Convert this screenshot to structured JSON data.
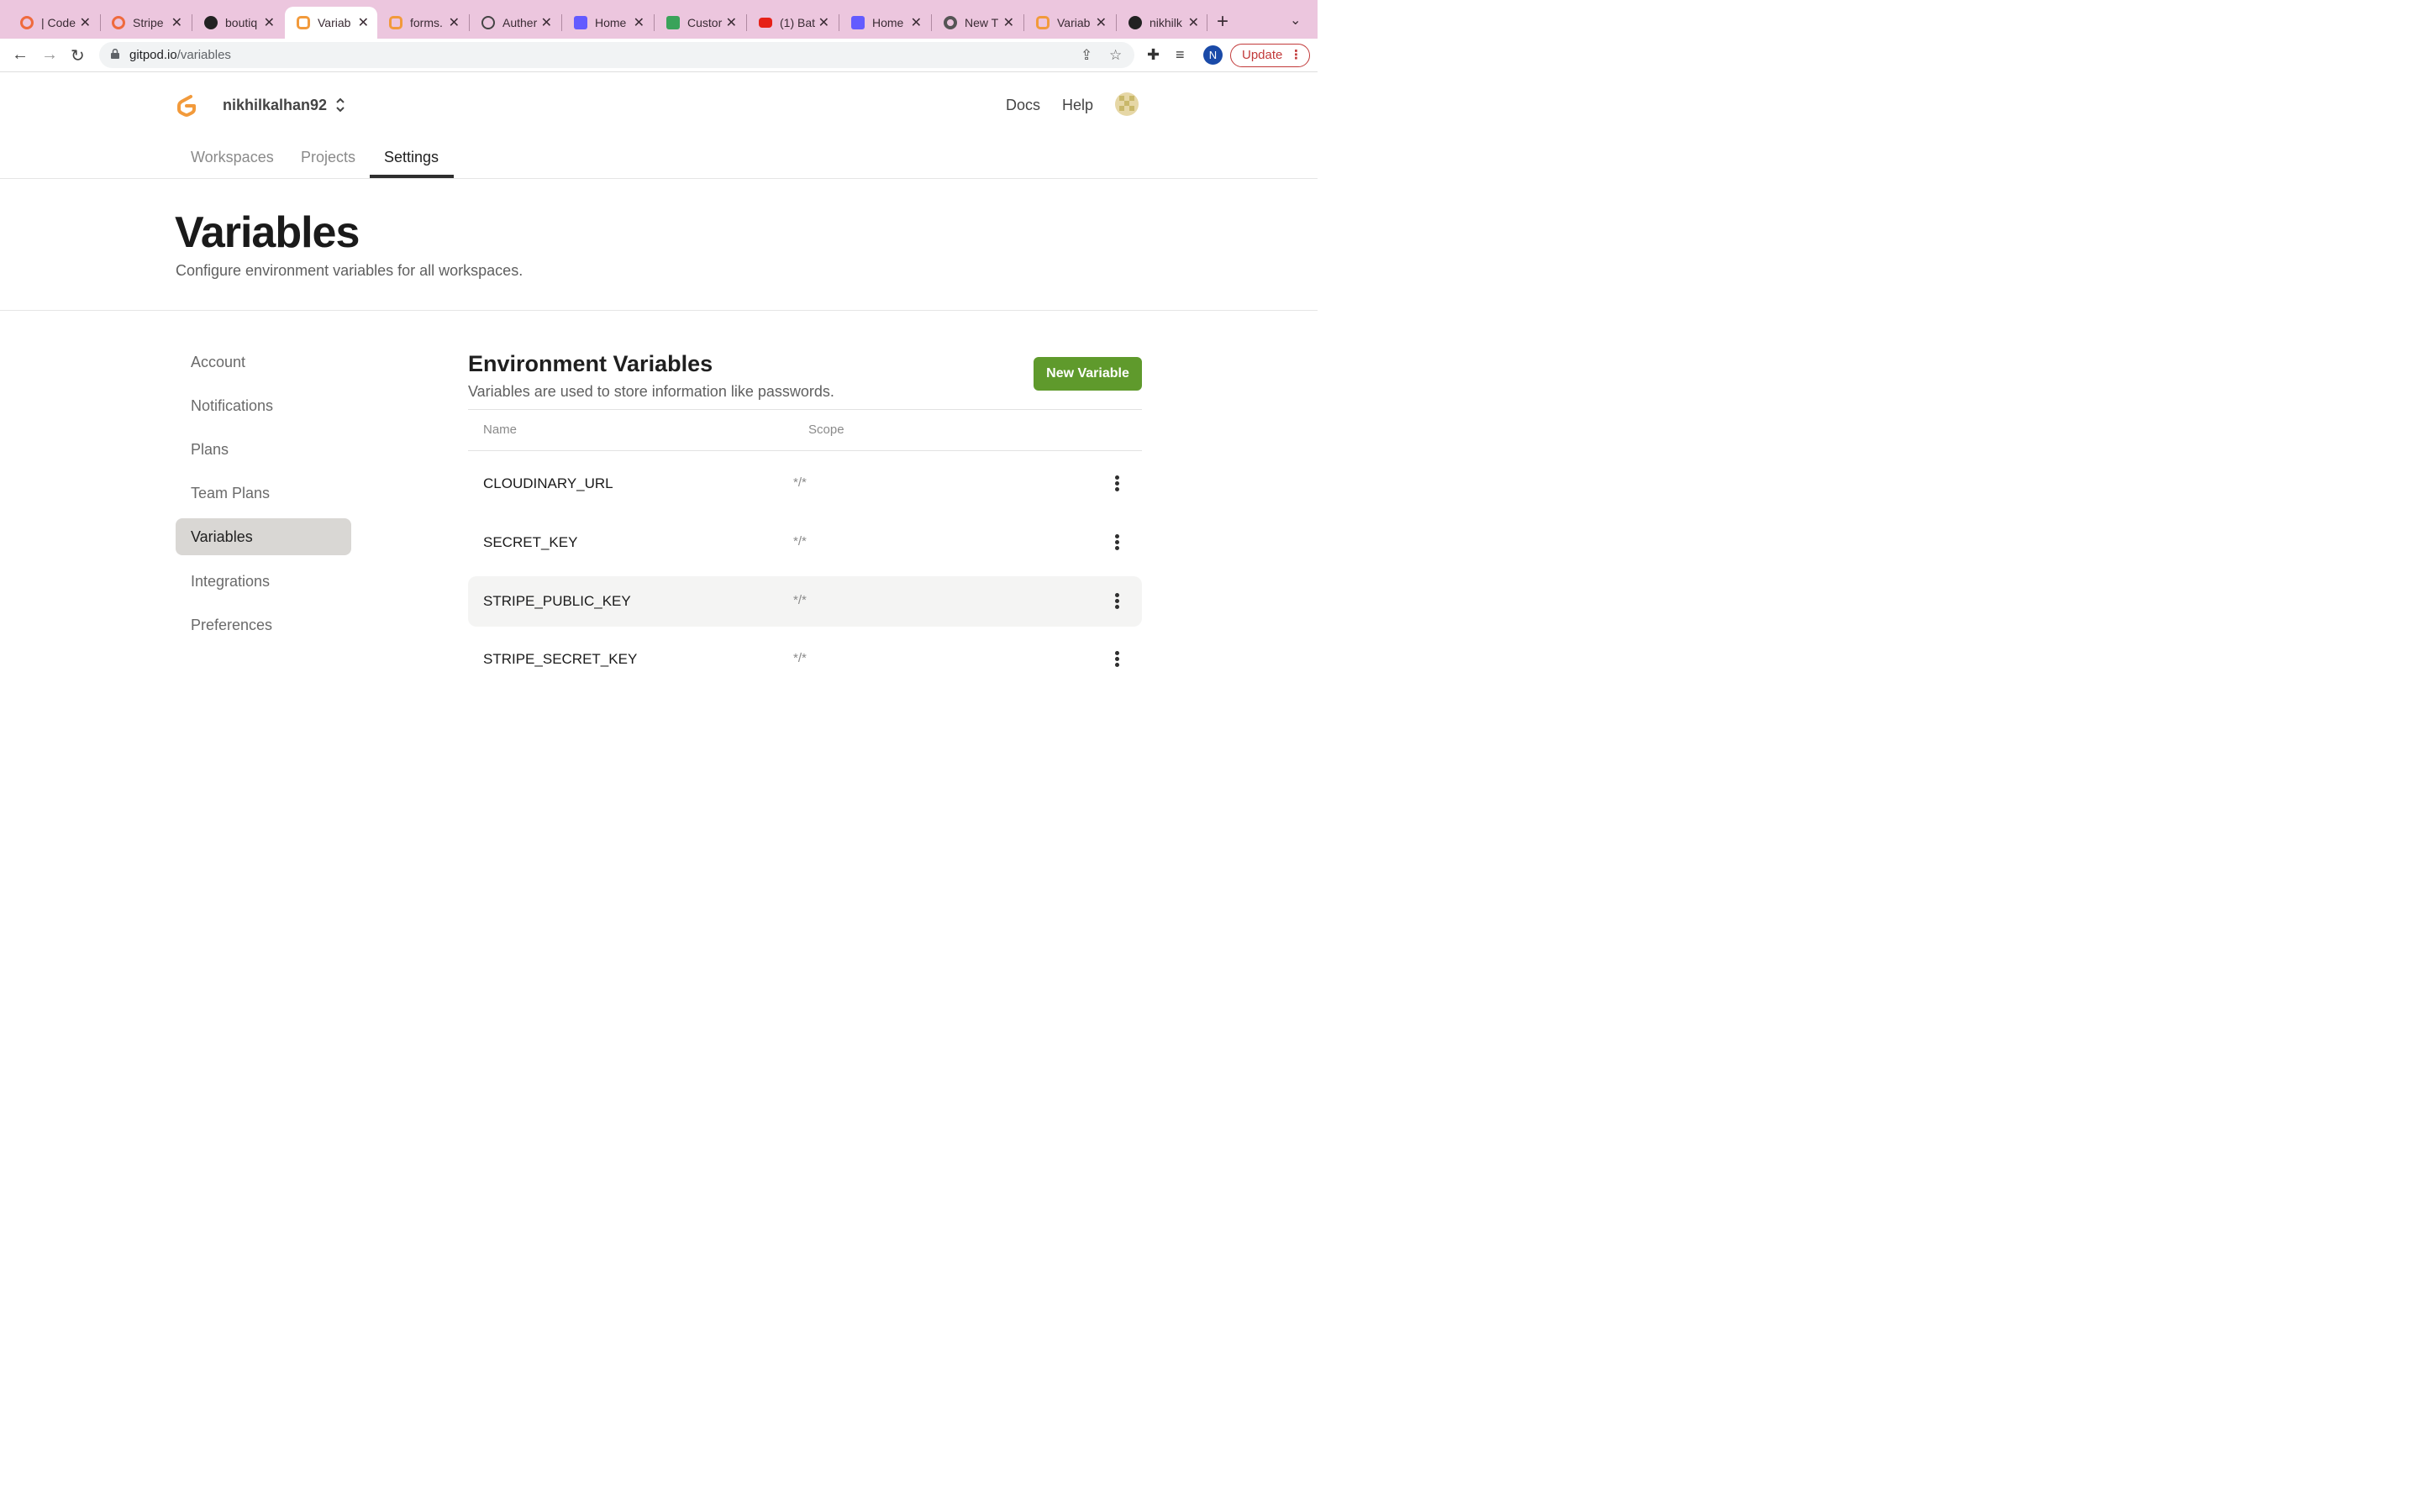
{
  "browser": {
    "tabs": [
      {
        "title": "| Code",
        "icon": "opencollective-icon",
        "color": "#ef6a3d"
      },
      {
        "title": "Stripe",
        "icon": "opencollective-icon",
        "color": "#ef6a3d"
      },
      {
        "title": "boutiq",
        "icon": "github-icon",
        "color": "#222222"
      },
      {
        "title": "Variab",
        "icon": "gitpod-icon",
        "color": "#f29a3b"
      },
      {
        "title": "forms.",
        "icon": "gitpod-icon",
        "color": "#f29a3b"
      },
      {
        "title": "Auther",
        "icon": "globe-icon",
        "color": "#444444"
      },
      {
        "title": "Home",
        "icon": "stripe-icon",
        "color": "#635bff"
      },
      {
        "title": "Custor",
        "icon": "sheets-icon",
        "color": "#3aa35a"
      },
      {
        "title": "(1) Bat",
        "icon": "youtube-icon",
        "color": "#e62117"
      },
      {
        "title": "Home",
        "icon": "stripe-icon",
        "color": "#635bff"
      },
      {
        "title": "New T",
        "icon": "chrome-icon",
        "color": "#555555"
      },
      {
        "title": "Variab",
        "icon": "gitpod-icon",
        "color": "#f29a3b"
      },
      {
        "title": "nikhilk",
        "icon": "github-icon",
        "color": "#222222"
      }
    ],
    "active_tab_index": 3,
    "url_host": "gitpod.io",
    "url_path": "/variables",
    "profile_initial": "N",
    "update_label": "Update",
    "accent_color": "#c23a3a"
  },
  "header": {
    "org_name": "nikhilkalhan92",
    "links": {
      "docs": "Docs",
      "help": "Help"
    },
    "tabs": {
      "workspaces": "Workspaces",
      "projects": "Projects",
      "settings": "Settings"
    },
    "active_tab": "Settings"
  },
  "page": {
    "title": "Variables",
    "subtitle": "Configure environment variables for all workspaces."
  },
  "sidebar": {
    "items": [
      "Account",
      "Notifications",
      "Plans",
      "Team Plans",
      "Variables",
      "Integrations",
      "Preferences"
    ],
    "active": "Variables"
  },
  "env": {
    "title": "Environment Variables",
    "description": "Variables are used to store information like passwords.",
    "new_button": "New Variable",
    "button_color": "#5f9a2c",
    "columns": {
      "name": "Name",
      "scope": "Scope"
    },
    "rows": [
      {
        "name": "CLOUDINARY_URL",
        "scope": "*/*"
      },
      {
        "name": "SECRET_KEY",
        "scope": "*/*"
      },
      {
        "name": "STRIPE_PUBLIC_KEY",
        "scope": "*/*"
      },
      {
        "name": "STRIPE_SECRET_KEY",
        "scope": "*/*"
      }
    ],
    "hovered_row": "STRIPE_PUBLIC_KEY"
  }
}
